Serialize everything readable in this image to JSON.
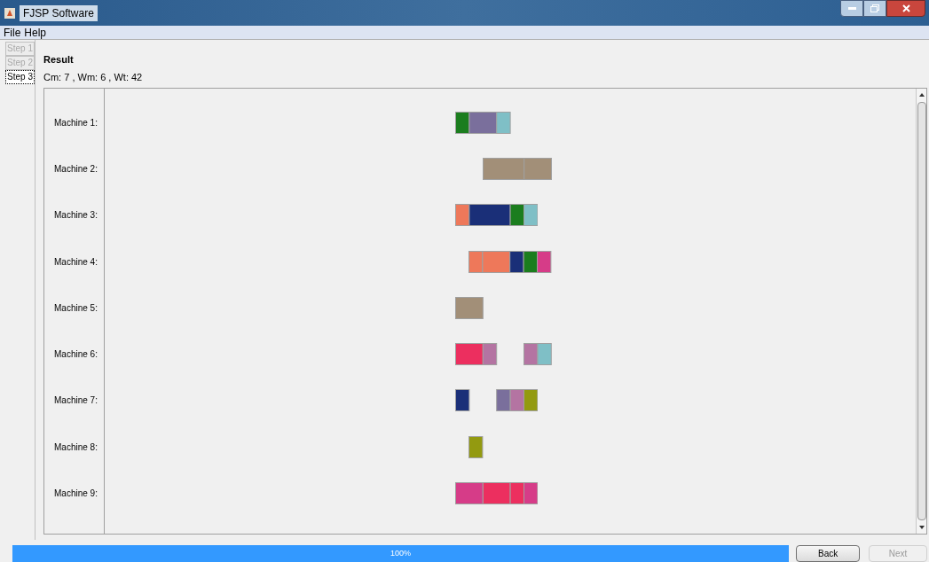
{
  "window": {
    "title": "FJSP Software"
  },
  "menu": [
    "File",
    "Help"
  ],
  "steps": [
    {
      "label": "Step 1",
      "selected": false,
      "disabled": true
    },
    {
      "label": "Step 2",
      "selected": false,
      "disabled": true
    },
    {
      "label": "Step 3",
      "selected": true,
      "disabled": false
    }
  ],
  "result": {
    "title": "Result",
    "summary": "Cm: 7 , Wm: 6 , Wt: 42"
  },
  "machines": [
    {
      "label": "Machine 1:"
    },
    {
      "label": "Machine 2:"
    },
    {
      "label": "Machine 3:"
    },
    {
      "label": "Machine 4:"
    },
    {
      "label": "Machine 5:"
    },
    {
      "label": "Machine 6:"
    },
    {
      "label": "Machine 7:"
    },
    {
      "label": "Machine 8:"
    },
    {
      "label": "Machine 9:"
    }
  ],
  "progress": {
    "level": 1,
    "text": "100%"
  },
  "buttons": [
    {
      "label": "Back",
      "disabled": false
    },
    {
      "label": "Next",
      "disabled": true
    }
  ]
}
